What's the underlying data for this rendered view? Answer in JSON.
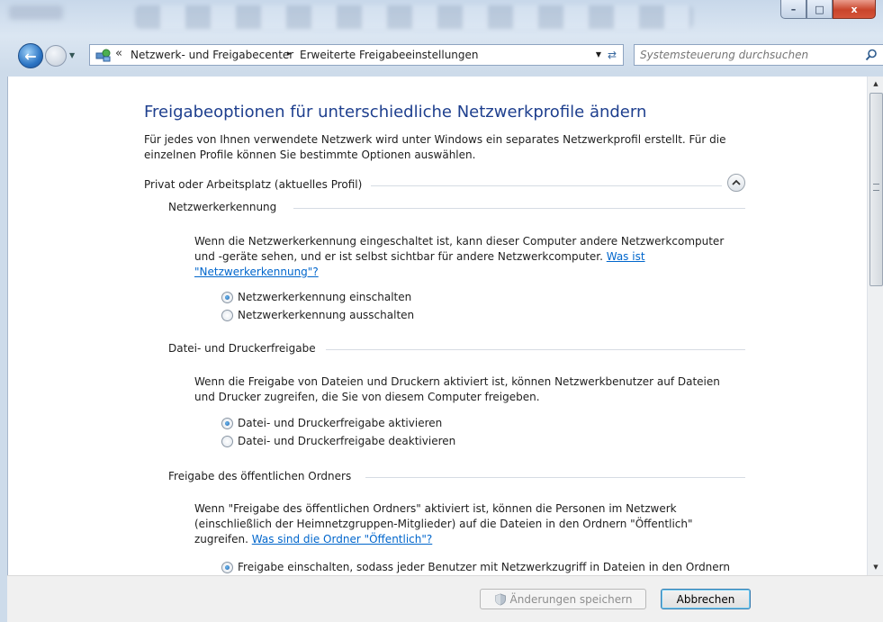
{
  "window": {
    "caption_buttons": {
      "minimize": "–",
      "maximize": "□",
      "close": "x"
    }
  },
  "address": {
    "chevron": "«",
    "crumbs": [
      "Netzwerk- und Freigabecenter",
      "Erweiterte Freigabeeinstellungen"
    ],
    "separator": "▸",
    "search_placeholder": "Systemsteuerung durchsuchen"
  },
  "content": {
    "title": "Freigabeoptionen für unterschiedliche Netzwerkprofile ändern",
    "description": "Für jedes von Ihnen verwendete Netzwerk wird unter Windows ein separates Netzwerkprofil erstellt. Für die einzelnen Profile können Sie bestimmte Optionen auswählen.",
    "profile": {
      "label": "Privat oder Arbeitsplatz (aktuelles Profil)",
      "expanded": true
    },
    "sections": {
      "discovery": {
        "title": "Netzwerkerkennung",
        "text_line1": "Wenn die Netzwerkerkennung eingeschaltet ist, kann dieser Computer andere Netzwerkcomputer",
        "text_line2": "und -geräte sehen, und er ist selbst sichtbar für andere Netzwerkcomputer.",
        "link_part1": "Was ist",
        "link_part2": "\"Netzwerkerkennung\"?",
        "options": [
          "Netzwerkerkennung einschalten",
          "Netzwerkerkennung ausschalten"
        ],
        "selected": 0
      },
      "file_sharing": {
        "title": "Datei- und Druckerfreigabe",
        "text_line1": "Wenn die Freigabe von Dateien und Druckern aktiviert ist, können Netzwerkbenutzer auf Dateien",
        "text_line2": "und Drucker zugreifen, die Sie von diesem Computer freigeben.",
        "options": [
          "Datei- und Druckerfreigabe aktivieren",
          "Datei- und Druckerfreigabe deaktivieren"
        ],
        "selected": 0
      },
      "public_folder": {
        "title": "Freigabe des öffentlichen Ordners",
        "text_line1": "Wenn \"Freigabe des öffentlichen Ordners\" aktiviert ist, können die Personen im Netzwerk",
        "text_line2": "(einschließlich der Heimnetzgruppen-Mitglieder) auf die Dateien in den Ordnern \"Öffentlich\"",
        "text_line3": "zugreifen.",
        "link": "Was sind die Ordner \"Öffentlich\"?",
        "options": [
          "Freigabe einschalten, sodass jeder Benutzer mit Netzwerkzugriff in Dateien in den Ordnern"
        ],
        "selected": 0
      }
    }
  },
  "footer": {
    "save_label": "Änderungen speichern",
    "cancel_label": "Abbrechen"
  },
  "colors": {
    "heading": "#1e3f8e",
    "link": "#0066cc",
    "close_button": "#c9442b"
  }
}
